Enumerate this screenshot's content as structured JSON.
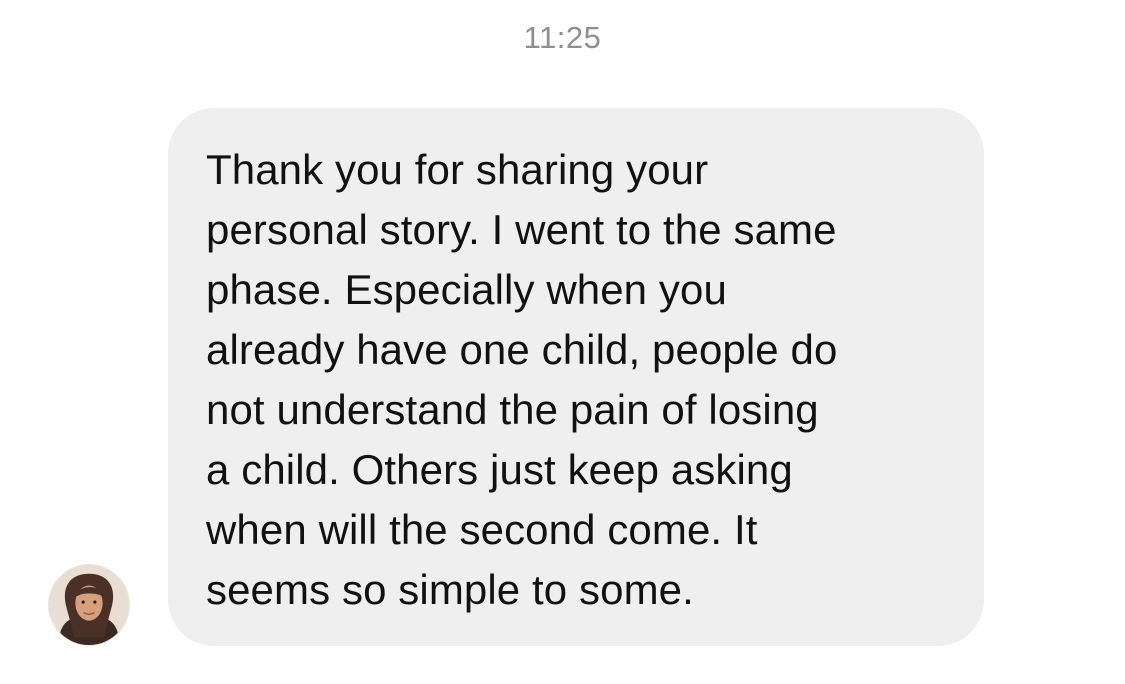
{
  "conversation": {
    "timestamp": "11:25",
    "message": {
      "text": "Thank you for sharing your\npersonal story. I went to the same\nphase. Especially when you\nalready have one child, people do\nnot understand the pain of losing\na child. Others just keep asking\nwhen will the second come. It\nseems so simple to some.",
      "bubble_color": "#efefef",
      "text_color": "#111111"
    },
    "sender": {
      "avatar_icon": "profile-photo"
    }
  },
  "colors": {
    "background": "#ffffff",
    "timestamp": "#8e8e93"
  }
}
